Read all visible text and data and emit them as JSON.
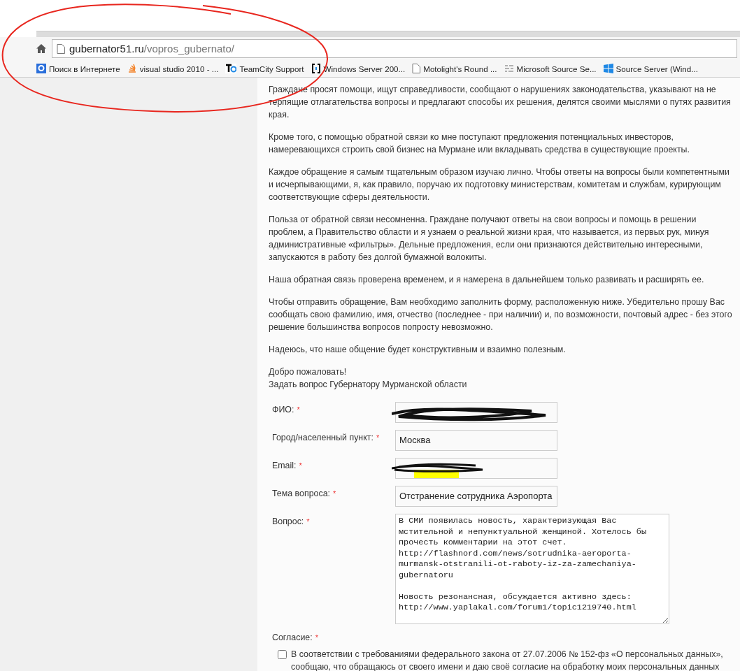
{
  "address_bar": {
    "domain": "gubernator51.ru",
    "path": "/vopros_gubernato/"
  },
  "bookmarks": [
    {
      "kind": "search",
      "label": "Поиск в Интернете"
    },
    {
      "kind": "stack",
      "label": "visual studio 2010 - ..."
    },
    {
      "kind": "tc",
      "label": "TeamCity Support"
    },
    {
      "kind": "bracket",
      "label": "Windows Server 200..."
    },
    {
      "kind": "page",
      "label": "Motolight's Round ..."
    },
    {
      "kind": "lines",
      "label": "Microsoft Source Se..."
    },
    {
      "kind": "windows",
      "label": "Source Server (Wind..."
    }
  ],
  "paragraphs": [
    "Граждане просят помощи, ищут справедливости, сообщают о нарушениях законодательства, указывают на не терпящие отлагательства вопросы и предлагают способы их решения, делятся своими мыслями о путях развития края.",
    "Кроме того, с помощью обратной связи ко мне поступают предложения потенциальных инвесторов, намеревающихся строить свой бизнес на Мурмане или вкладывать средства в существующие проекты.",
    "Каждое обращение я самым тщательным образом изучаю лично. Чтобы ответы на вопросы были компетентными и исчерпывающими, я, как правило, поручаю их подготовку министерствам, комитетам и службам, курирующим соответствующие сферы деятельности.",
    "Польза от обратной связи несомненна. Граждане получают ответы на свои вопросы и помощь в решении проблем, а Правительство области и я узнаем о реальной жизни края, что называется, из первых рук, минуя административные «фильтры». Дельные предложения, если они признаются действительно интересными, запускаются в работу без долгой бумажной волокиты.",
    "Наша обратная связь проверена временем, и я намерена в дальнейшем только развивать и расширять ее.",
    "Чтобы отправить обращение, Вам необходимо заполнить форму, расположенную ниже. Убедительно прошу Вас сообщать свою фамилию, имя, отчество (последнее - при наличии) и, по возможности, почтовый адрес - без этого решение большинства вопросов попросту невозможно.",
    "Надеюсь, что наше общение будет конструктивным и взаимно полезным."
  ],
  "greeting": [
    "Добро пожаловать!",
    "Задать вопрос Губернатору Мурманской области"
  ],
  "form": {
    "fields": [
      {
        "kind": "redacted",
        "label": "ФИО:",
        "required_mark": "*"
      },
      {
        "kind": "text",
        "label": "Город/населенный пункт:",
        "required_mark": "*",
        "value": "Москва"
      },
      {
        "kind": "redacted",
        "label": "Email:",
        "required_mark": "*"
      },
      {
        "kind": "text",
        "label": "Тема вопроса:",
        "required_mark": "*",
        "value": "Отстранение сотрудника Аэропорта"
      },
      {
        "kind": "textarea",
        "label": "Вопрос:",
        "required_mark": "*",
        "value": "В СМИ появилась новость, характеризующая Вас мстительной и непунктуальной женщиной. Хотелось бы прочесть комментарии на этот счет. http://flashnord.com/news/sotrudnika-aeroporta-murmansk-otstranili-ot-raboty-iz-za-zamechaniya-gubernatoru\n\nНовость резонансная, обсуждается активно здесь: http://www.yaplakal.com/forum1/topic1219740.html"
      }
    ],
    "consent": {
      "label": "Согласие:",
      "required_mark": "*",
      "checked": false,
      "text": "В соответствии с требованиями федерального закона от 27.07.2006 № 152-фз «О персональных данных», сообщаю, что обращаюсь от своего имени и даю своё согласие на обработку моих персональных данных"
    }
  }
}
